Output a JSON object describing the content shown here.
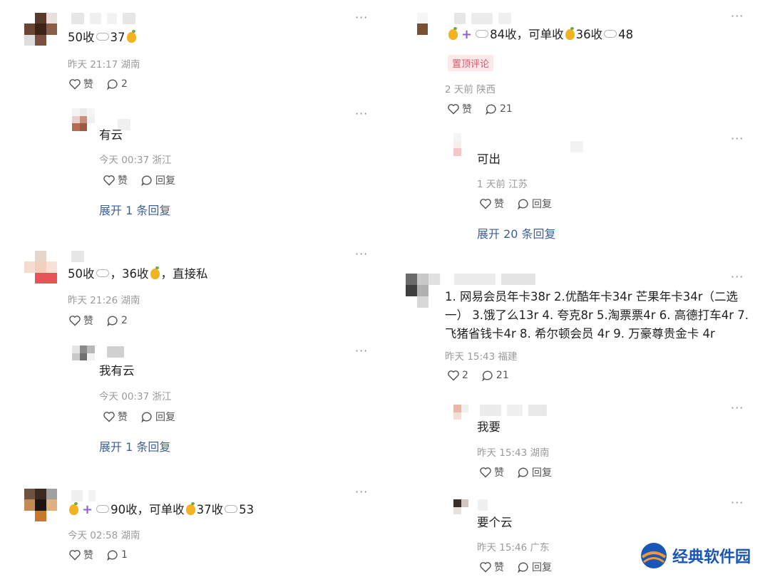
{
  "icon_names": {
    "heart": "heart-outline-icon",
    "comment": "comment-bubble-icon",
    "more": "more-dots-icon",
    "mango": "mango-emoji-icon",
    "cloud": "cloud-emoji-icon",
    "plus": "plus-emoji-icon"
  },
  "left": {
    "c1": {
      "text_a": "50收",
      "text_b": "37",
      "meta": "昨天 21:17 湖南",
      "like": "赞",
      "comments": "2",
      "reply": {
        "text": "有云",
        "meta": "今天 00:37 浙江",
        "like": "赞",
        "reply_label": "回复"
      },
      "expand": "展开 1 条回复"
    },
    "c2": {
      "text_a": "50收",
      "text_b": "，36收",
      "text_c": "，直接私",
      "meta": "昨天 21:26 湖南",
      "like": "赞",
      "comments": "2",
      "reply": {
        "text": "我有云",
        "meta": "今天 00:37 浙江",
        "like": "赞",
        "reply_label": "回复"
      },
      "expand": "展开 1 条回复"
    },
    "c3": {
      "text_a": "90收，可单收",
      "text_b": "37收",
      "text_c": "53",
      "meta": "今天 02:58 湖南",
      "like": "赞",
      "comments": "1"
    }
  },
  "right": {
    "c1": {
      "text_a": "84收，可单收",
      "text_b": "36收",
      "text_c": "48",
      "pin": "置顶评论",
      "meta": "2 天前 陕西",
      "like": "赞",
      "comments": "21",
      "reply": {
        "text": "可出",
        "meta": "1 天前 江苏",
        "like": "赞",
        "reply_label": "回复"
      },
      "expand": "展开 20 条回复"
    },
    "c2": {
      "text": "1. 网易会员年卡38r 2.优酷年卡34r 芒果年卡34r（二选一） 3.饿了么13r 4. 夸克8r 5.淘票票4r 6. 高德打车4r 7.飞猪省钱卡4r 8. 希尔顿会员 4r 9. 万豪尊贵金卡 4r",
      "meta": "昨天 15:43 福建",
      "likes": "2",
      "comments": "21",
      "reply1": {
        "text": "我要",
        "meta": "昨天 15:43 湖南",
        "like": "赞",
        "reply_label": "回复"
      },
      "reply2": {
        "text": "要个云",
        "meta": "昨天 15:46 广东",
        "like": "赞",
        "reply_label": "回复"
      }
    }
  },
  "watermark": {
    "text": "经典软件园",
    "color": "#1a56b8"
  },
  "colors": {
    "link": "#3d5f9c",
    "pin_bg": "#fde8ea",
    "pin_text": "#e0566a",
    "meta": "#9a9a9a"
  }
}
